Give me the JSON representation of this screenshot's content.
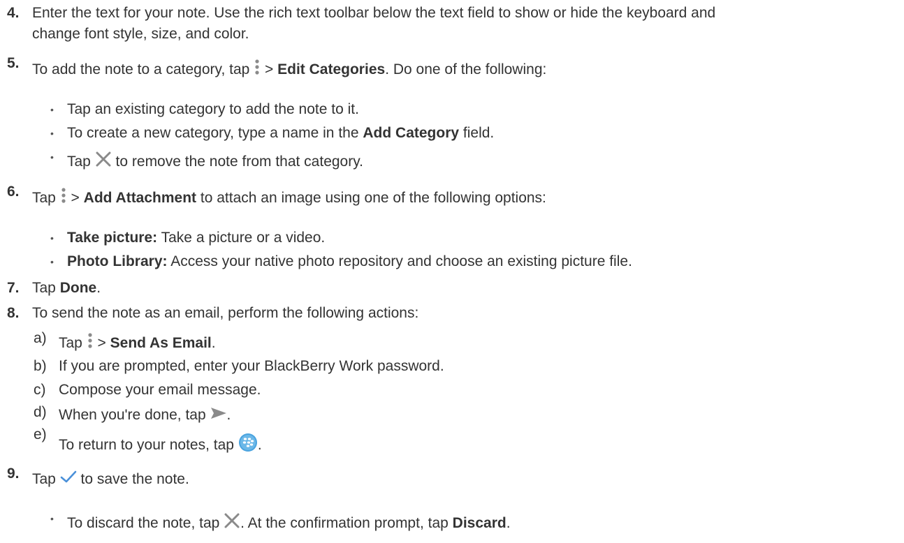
{
  "steps": {
    "s4": {
      "number": "4.",
      "line1": "Enter the text for your note. Use the rich text toolbar below the text field to show or hide the keyboard and",
      "line2": "change font style, size, and color."
    },
    "s5": {
      "number": "5.",
      "pre": "To add the note to a category, tap",
      "sep": ">",
      "bold": "Edit Categories",
      "post": ". Do one of the following:",
      "bullets": {
        "b1": "Tap an existing category to add the note to it.",
        "b2_pre": "To create a new category, type a name in the",
        "b2_bold": "Add Category",
        "b2_post": "field.",
        "b3_pre": "Tap",
        "b3_post": "to remove the note from that category."
      }
    },
    "s6": {
      "number": "6.",
      "pre": "Tap",
      "sep": ">",
      "bold": "Add Attachment",
      "post": "to attach an image using one of the following options:",
      "bullets": {
        "b1_bold": "Take picture:",
        "b1_text": "Take a picture or a video.",
        "b2_bold": "Photo Library:",
        "b2_text": "Access your native photo repository and choose an existing picture file."
      }
    },
    "s7": {
      "number": "7.",
      "pre": "Tap",
      "bold": "Done",
      "post": "."
    },
    "s8": {
      "number": "8.",
      "text": "To send the note as an email, perform the following actions:",
      "subs": {
        "a_label": "a)",
        "a_pre": "Tap",
        "a_sep": ">",
        "a_bold": "Send As Email",
        "a_post": ".",
        "b_label": "b)",
        "b_text": "If you are prompted, enter your BlackBerry Work password.",
        "c_label": "c)",
        "c_text": "Compose your email message.",
        "d_label": "d)",
        "d_pre": "When you're done, tap",
        "d_post": ".",
        "e_label": "e)",
        "e_pre": "To return to your notes, tap",
        "e_post": "."
      }
    },
    "s9": {
      "number": "9.",
      "pre": "Tap",
      "post": "to save the note.",
      "bullet_pre": "To discard the note, tap",
      "bullet_mid": ". At the confirmation prompt, tap",
      "bullet_bold": "Discard",
      "bullet_post": "."
    }
  },
  "icons": {
    "menu": "more-vertical-icon",
    "close": "close-x-icon",
    "send": "send-arrow-icon",
    "blackberry": "blackberry-logo-icon",
    "check": "checkmark-icon"
  },
  "colors": {
    "text": "#333333",
    "icon_gray": "#8a8a8a",
    "check_blue": "#4a90d9",
    "bb_blue": "#4aa3df"
  }
}
